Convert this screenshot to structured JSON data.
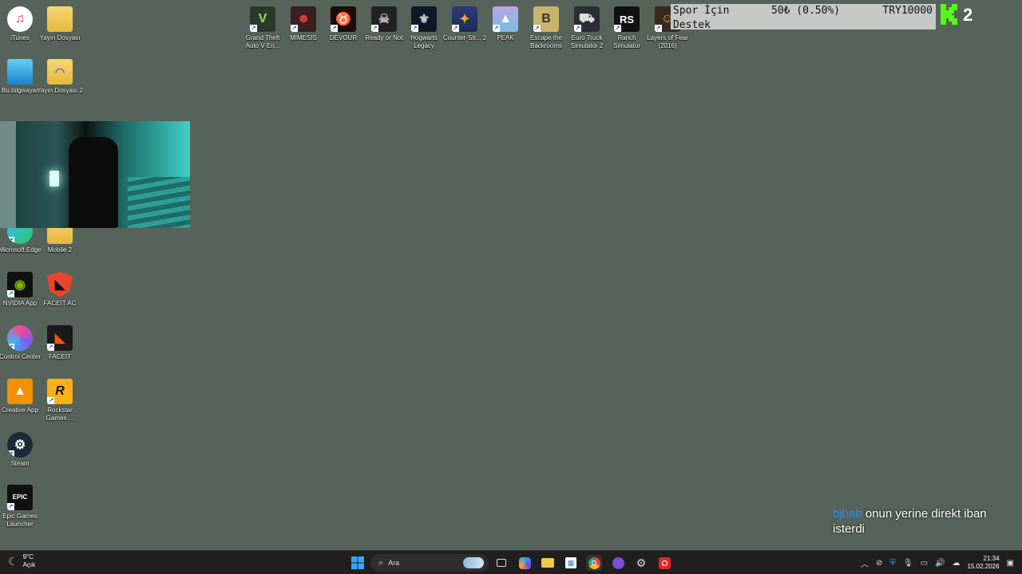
{
  "desktop": {
    "left_icons": [
      {
        "label": "iTunes"
      },
      {
        "label": "Yayın Dosyası"
      },
      {
        "label": "Bu bilgisayar"
      },
      {
        "label": "Yayın Dosyası 2"
      },
      {
        "label": "Microsoft Edge"
      },
      {
        "label": "Mobile 2"
      },
      {
        "label": "NVIDIA App"
      },
      {
        "label": "FACEIT AC"
      },
      {
        "label": "Control Center"
      },
      {
        "label": "FACEIT"
      },
      {
        "label": "Creative App"
      },
      {
        "label": "Rockstar Games ..."
      },
      {
        "label": "Steam"
      },
      {
        "label": "Epic Games Launcher"
      }
    ],
    "top_icons": [
      {
        "label": "Grand Theft Auto V En..."
      },
      {
        "label": "MIMESIS"
      },
      {
        "label": "DEVOUR"
      },
      {
        "label": "Ready or Not"
      },
      {
        "label": "Hogwarts Legacy"
      },
      {
        "label": "Counter-Str... 2"
      },
      {
        "label": "PEAK"
      },
      {
        "label": "Escape the Backrooms"
      },
      {
        "label": "Euro Truck Simulator 2"
      },
      {
        "label": "Ranch Simulator"
      },
      {
        "label": "Layers of Fear (2016)"
      }
    ]
  },
  "overlay": {
    "donation_title_1": "Spor İçin",
    "donation_title_2": "Destek",
    "donation_amount": "50₺ (0.50%)",
    "donation_goal": "TRY10000",
    "kick_count": "2",
    "chat_user": "bjbab",
    "chat_message": "onun yerine direkt iban isterdi"
  },
  "taskbar": {
    "weather_temp": "9°C",
    "weather_state": "Açık",
    "search_placeholder": "Ara",
    "time": "21:34",
    "date": "15.02.2026"
  },
  "colors": {
    "desktop_bg": "#56635a",
    "taskbar_bg": "#1f1f1f",
    "kick_green": "#53fc18",
    "chat_user": "#2b86e6"
  }
}
